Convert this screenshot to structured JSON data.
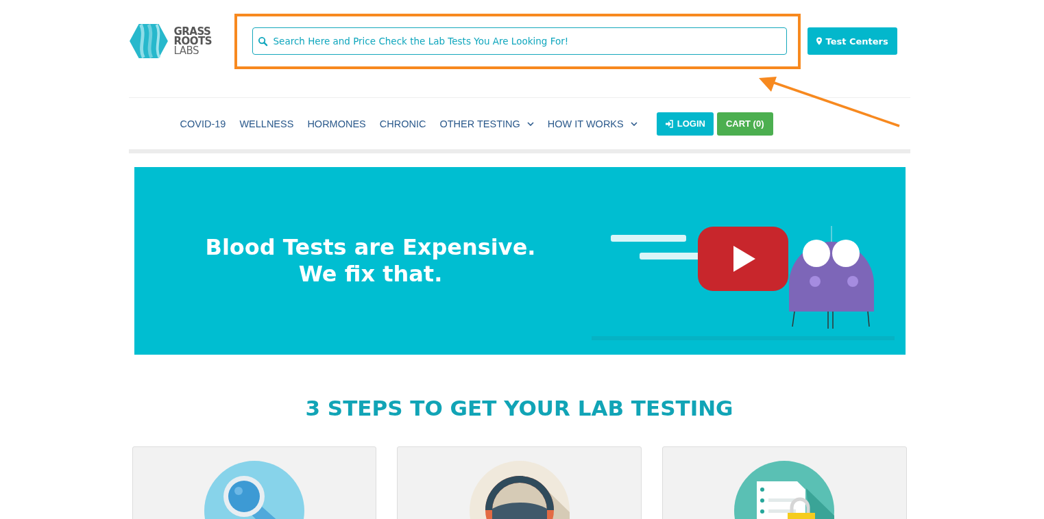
{
  "header": {
    "logo_lines": [
      "GRASS",
      "ROOTS",
      "LABS"
    ],
    "search": {
      "placeholder": "Search Here and Price Check the Lab Tests You Are Looking For!"
    },
    "test_centers_button": "Test Centers"
  },
  "nav": {
    "items": [
      {
        "label": "COVID-19",
        "dropdown": false
      },
      {
        "label": "WELLNESS",
        "dropdown": false
      },
      {
        "label": "HORMONES",
        "dropdown": false
      },
      {
        "label": "CHRONIC",
        "dropdown": false
      },
      {
        "label": "OTHER TESTING",
        "dropdown": true
      },
      {
        "label": "HOW IT WORKS",
        "dropdown": true
      }
    ],
    "login_button": "LOGIN",
    "cart_button": "CART (0)"
  },
  "hero": {
    "heading_lines": [
      "Blood Tests are Expensive.",
      "We fix that."
    ],
    "video": {
      "kind": "picture"
    }
  },
  "steps": {
    "title": "3 STEPS TO GET YOUR LAB TESTING",
    "cards": [
      {
        "kind": "search"
      },
      {
        "kind": "steering"
      },
      {
        "kind": "document"
      }
    ]
  }
}
